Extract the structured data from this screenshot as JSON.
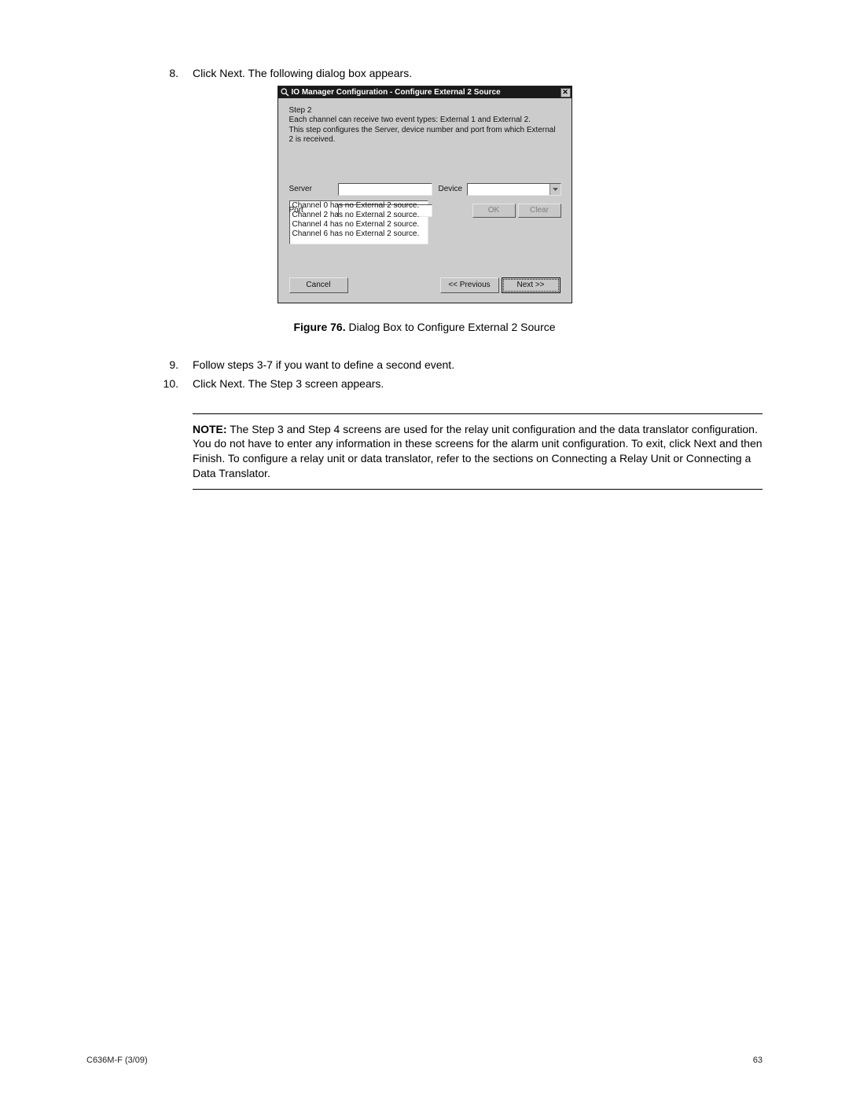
{
  "steps": {
    "s8": {
      "num": "8.",
      "text": "Click Next. The following dialog box appears."
    },
    "s9": {
      "num": "9.",
      "text": "Follow steps 3-7 if you want to define a second event."
    },
    "s10": {
      "num": "10.",
      "text": "Click Next. The Step 3 screen appears."
    }
  },
  "dialog": {
    "title": "IO Manager Configuration - Configure External 2 Source",
    "close": "✕",
    "step_label": "Step 2",
    "desc_line1": "Each channel can receive two event types: External 1 and External 2.",
    "desc_line2": "This step configures the Server, device number and port from which External 2 is received.",
    "labels": {
      "server": "Server",
      "device": "Device",
      "port": "Port"
    },
    "buttons": {
      "ok": "OK",
      "clear": "Clear",
      "cancel": "Cancel",
      "previous": "<< Previous",
      "next": "Next >>"
    },
    "channels": {
      "c0": "Channel 0 has no External 2 source.",
      "c2": "Channel 2 has no External 2 source.",
      "c4": "Channel 4 has no External 2 source.",
      "c6": "Channel 6 has no External 2 source."
    }
  },
  "figure": {
    "label": "Figure 76.",
    "caption": "  Dialog Box to Configure External 2 Source"
  },
  "note": {
    "label": "NOTE:",
    "body": "  The Step 3 and Step 4 screens are used for the relay unit configuration and the data translator configuration. You do not have to enter any information in these screens for the alarm unit configuration. To exit, click Next and then Finish. To configure a relay unit or data translator, refer to the sections on Connecting a Relay Unit or Connecting a Data Translator."
  },
  "footer": {
    "left": "C636M-F (3/09)",
    "right": "63"
  }
}
